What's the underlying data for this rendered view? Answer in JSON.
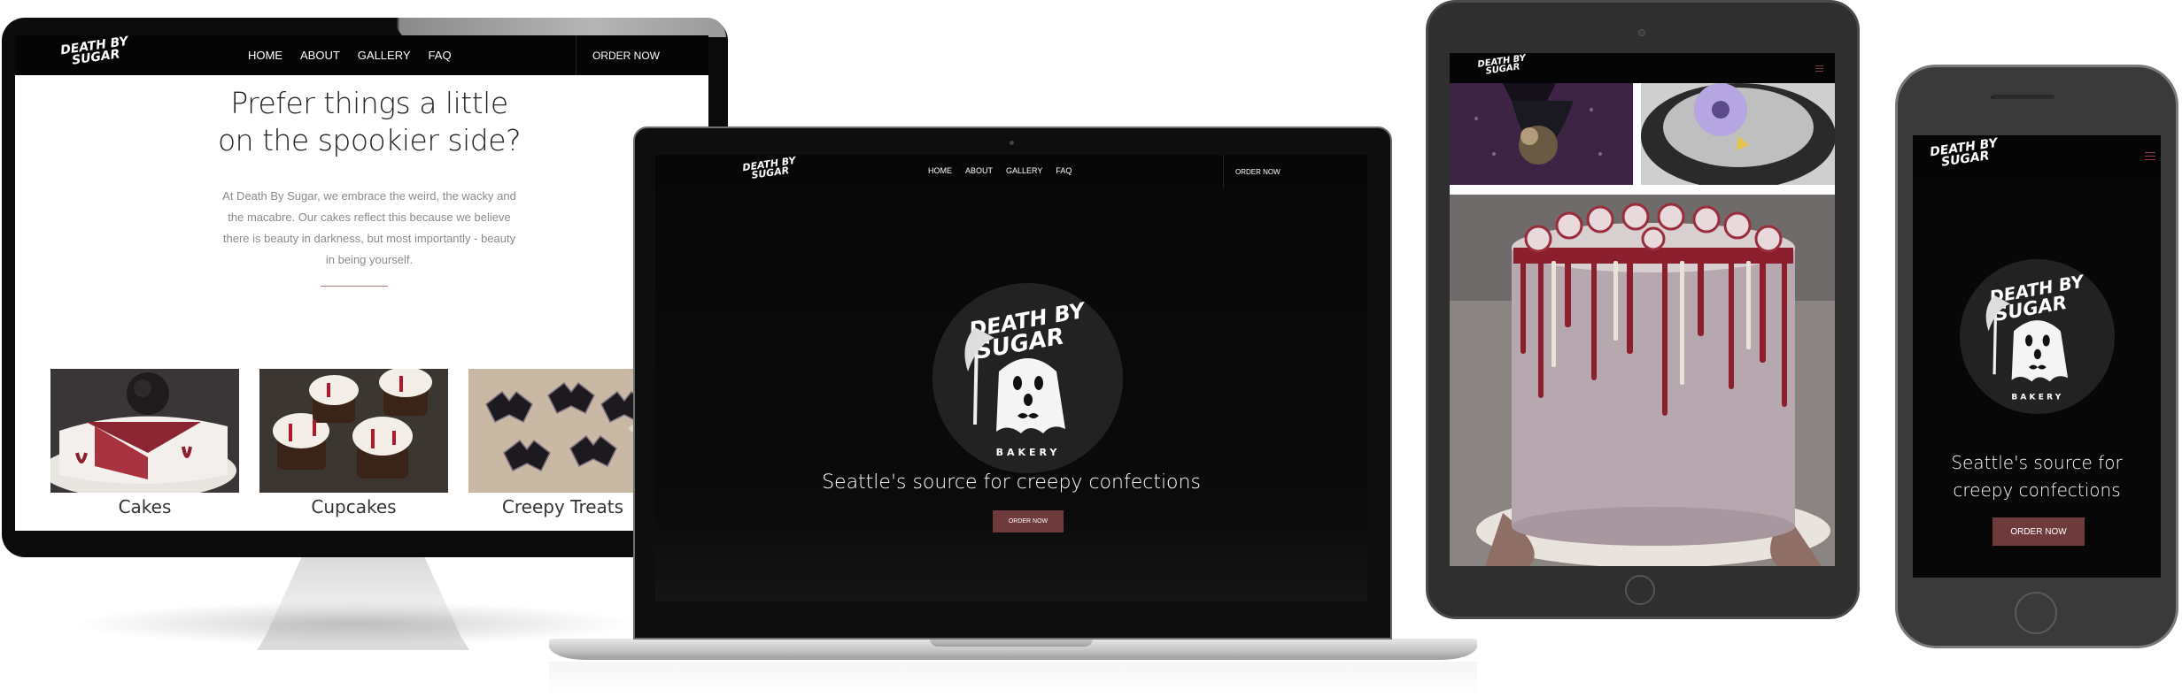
{
  "brand": {
    "logo_line1": "DEATH BY",
    "logo_line2": "SUGAR",
    "bakery": "BAKERY"
  },
  "nav": {
    "home": "HOME",
    "about": "ABOUT",
    "gallery": "GALLERY",
    "faq": "FAQ",
    "order": "ORDER NOW"
  },
  "desktop": {
    "heading_line1": "Prefer things a little",
    "heading_line2": "on the spookier side?",
    "body_lines": [
      "At Death By Sugar, we embrace the weird, the wacky and",
      "the macabre. Our cakes reflect this because we believe",
      "there is beauty in darkness, but most importantly - beauty",
      "in being yourself."
    ],
    "cards": [
      {
        "label": "Cakes"
      },
      {
        "label": "Cupcakes"
      },
      {
        "label": "Creepy Treats"
      }
    ]
  },
  "laptop": {
    "tagline": "Seattle's source for creepy confections",
    "cta": "ORDER NOW"
  },
  "phone": {
    "tagline_line1": "Seattle's source for",
    "tagline_line2": "creepy confections",
    "cta": "ORDER NOW"
  },
  "colors": {
    "accent": "#6e3a3c",
    "dark": "#050505",
    "frosting": "#b3a3ab",
    "drip": "#8c1f2e"
  }
}
